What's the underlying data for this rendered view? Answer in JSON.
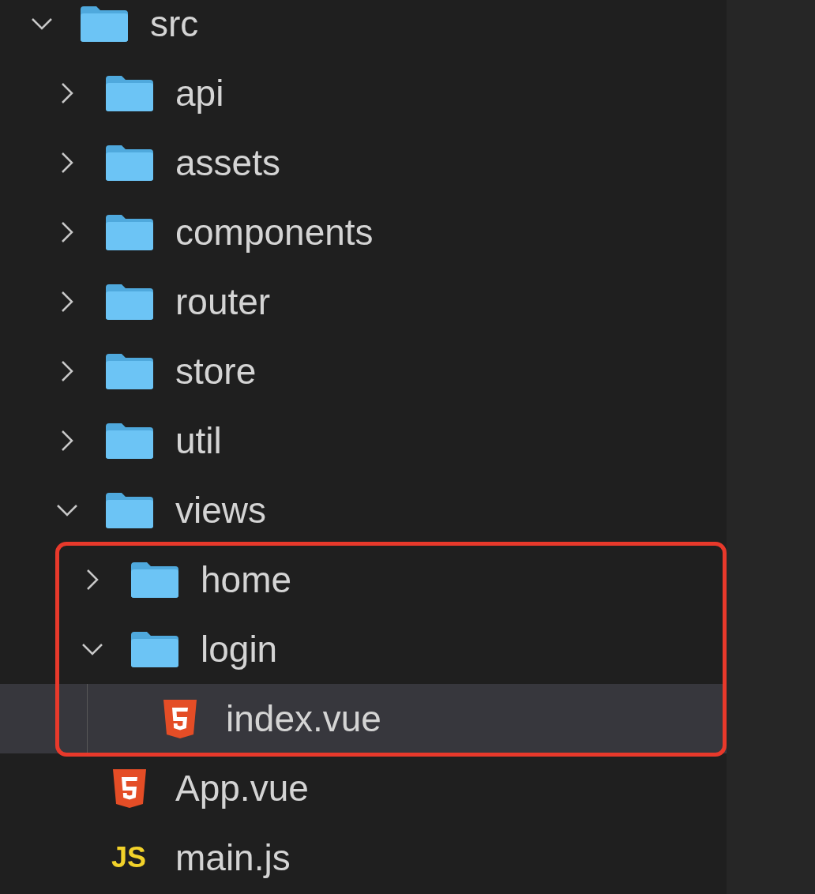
{
  "tree": [
    {
      "name": "src",
      "kind": "folder",
      "expanded": true,
      "selected": false,
      "boxed": false,
      "children": [
        {
          "name": "api",
          "kind": "folder",
          "expanded": false,
          "selected": false,
          "boxed": false
        },
        {
          "name": "assets",
          "kind": "folder",
          "expanded": false,
          "selected": false,
          "boxed": false
        },
        {
          "name": "components",
          "kind": "folder",
          "expanded": false,
          "selected": false,
          "boxed": false
        },
        {
          "name": "router",
          "kind": "folder",
          "expanded": false,
          "selected": false,
          "boxed": false
        },
        {
          "name": "store",
          "kind": "folder",
          "expanded": false,
          "selected": false,
          "boxed": false
        },
        {
          "name": "util",
          "kind": "folder",
          "expanded": false,
          "selected": false,
          "boxed": false
        },
        {
          "name": "views",
          "kind": "folder",
          "expanded": true,
          "selected": false,
          "boxed": false,
          "children": [
            {
              "name": "home",
              "kind": "folder",
              "expanded": false,
              "selected": false,
              "boxed": true
            },
            {
              "name": "login",
              "kind": "folder",
              "expanded": true,
              "selected": false,
              "boxed": true,
              "children": [
                {
                  "name": "index.vue",
                  "kind": "html",
                  "selected": true,
                  "boxed": true
                }
              ]
            }
          ]
        },
        {
          "name": "App.vue",
          "kind": "html",
          "selected": false,
          "boxed": false
        },
        {
          "name": "main.js",
          "kind": "js",
          "badge": "JS",
          "selected": false,
          "boxed": false
        }
      ]
    }
  ]
}
